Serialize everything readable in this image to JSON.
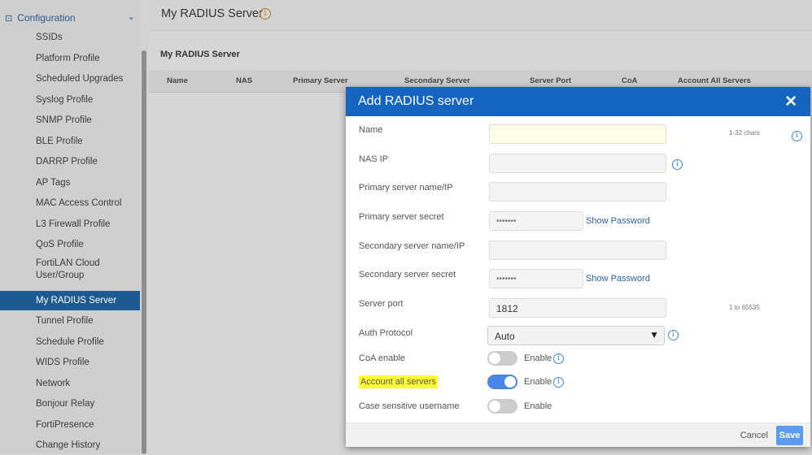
{
  "sidebar": {
    "section": "Configuration",
    "items": [
      "SSIDs",
      "Platform Profile",
      "Scheduled Upgrades",
      "Syslog Profile",
      "SNMP Profile",
      "BLE Profile",
      "DARRP Profile",
      "AP Tags",
      "MAC Access Control",
      "L3 Firewall Profile",
      "QoS Profile",
      "FortiLAN Cloud User/Group",
      "My RADIUS Server",
      "Tunnel Profile",
      "Schedule Profile",
      "WIDS Profile",
      "Network",
      "Bonjour Relay",
      "FortiPresence",
      "Change History"
    ],
    "selected": "My RADIUS Server"
  },
  "page": {
    "title": "My RADIUS Server",
    "section_title": "My RADIUS Server",
    "columns": [
      "Name",
      "NAS",
      "Primary Server",
      "Secondary Server",
      "Server Port",
      "CoA",
      "Account All Servers"
    ]
  },
  "modal": {
    "title": "Add RADIUS server",
    "fields": {
      "name": "Name",
      "name_hint": "1-32 chars",
      "nas_ip": "NAS IP",
      "primary_name": "Primary server name/IP",
      "primary_secret": "Primary server secret",
      "primary_secret_value": "•••••••",
      "secondary_name": "Secondary server name/IP",
      "secondary_secret": "Secondary server secret",
      "secondary_secret_value": "•••••••",
      "show_password": "Show Password",
      "server_port": "Server port",
      "server_port_value": "1812",
      "port_hint": "1 to 65535",
      "auth_protocol": "Auth Protocol",
      "auth_protocol_value": "Auto",
      "coa": "CoA enable",
      "account_all": "Account all servers",
      "case_sensitive": "Case sensitive username",
      "enable": "Enable"
    },
    "toggles": {
      "coa": false,
      "account_all": true,
      "case_sensitive": false
    },
    "cancel": "Cancel",
    "save": "Save"
  },
  "colors": {
    "header": "#1565c0",
    "selected": "#1d5a91",
    "highlight": "#ffff33"
  }
}
